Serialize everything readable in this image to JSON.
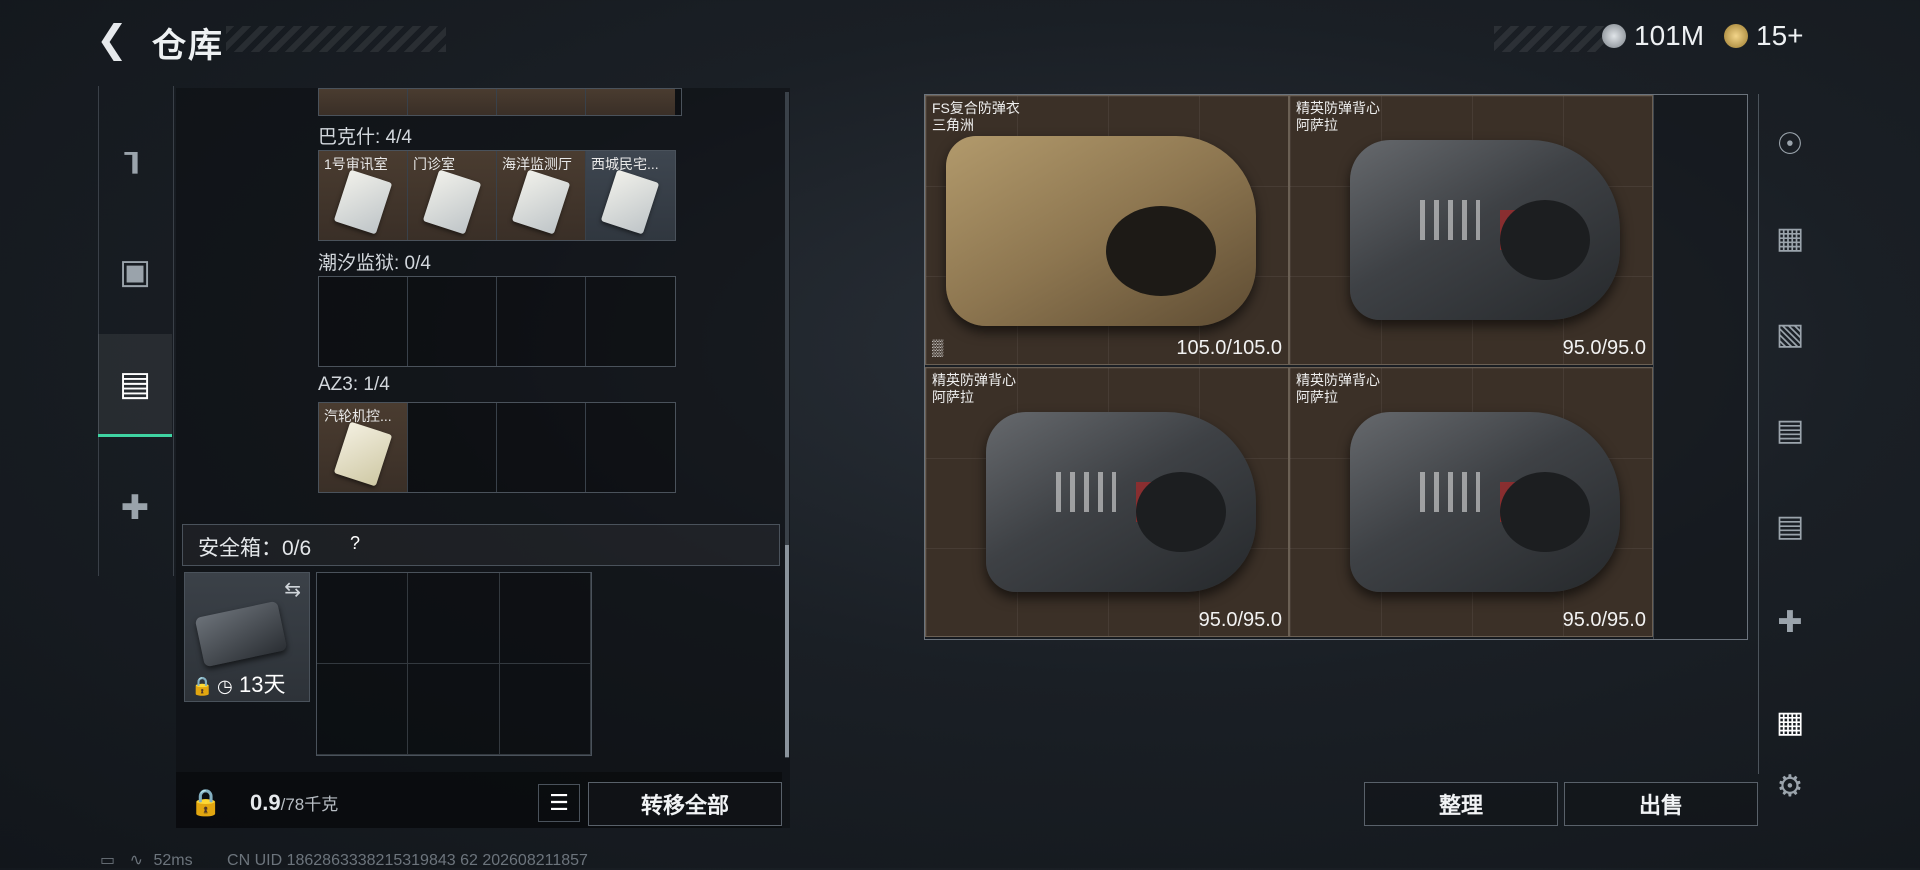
{
  "header": {
    "back_icon": "chevron-left-icon",
    "title": "仓库",
    "currencies": [
      {
        "icon": "coin-silver-icon",
        "value": "101M",
        "color": "#b8bfc6"
      },
      {
        "icon": "coin-gold-icon",
        "value": "15+",
        "color": "#d4b15e"
      }
    ]
  },
  "left_rail": {
    "items": [
      {
        "icon": "pistol-icon",
        "active": false
      },
      {
        "icon": "armor-icon",
        "active": false
      },
      {
        "icon": "backpack-icon",
        "active": true
      },
      {
        "icon": "medkit-icon",
        "active": false
      }
    ]
  },
  "keychains": [
    {
      "label": "巴克什: 4/4",
      "slots": [
        "1号审讯室",
        "门诊室",
        "海洋监测厅",
        "西城民宅..."
      ]
    },
    {
      "label": "潮汐监狱: 0/4",
      "slots": [
        "",
        "",
        "",
        ""
      ]
    },
    {
      "label": "AZ3: 1/4",
      "slots": [
        "汽轮机控...",
        "",
        "",
        ""
      ]
    }
  ],
  "safe_box": {
    "label": "安全箱：0/6",
    "help": "?",
    "duration": "13天",
    "swap_icon": "swap-arrows-icon"
  },
  "bottom": {
    "weight": "0.9",
    "weight_max": "/78千克",
    "transfer_all": "转移全部"
  },
  "items": [
    {
      "name": "FS复合防弹衣",
      "source": "三角洲",
      "durability": "105.0/105.0",
      "style": "tan",
      "no_container": true
    },
    {
      "name": "精英防弹背心",
      "source": "阿萨拉",
      "durability": "95.0/95.0",
      "style": "black"
    },
    {
      "name": "精英防弹背心",
      "source": "阿萨拉",
      "durability": "95.0/95.0",
      "style": "black"
    },
    {
      "name": "精英防弹背心",
      "source": "阿萨拉",
      "durability": "95.0/95.0",
      "style": "black"
    }
  ],
  "actions": {
    "organize": "整理",
    "sell": "出售"
  },
  "right_rail": [
    "helmet-icon",
    "armor-tier-icon",
    "backpack-tier-icon",
    "rig-tier-icon",
    "rig-tier-icon",
    "medkit-tier-icon",
    "armor-slot-icon",
    "gear-icon"
  ],
  "status_bar": {
    "ping": "52ms",
    "uid": "CN UID 1862863338215319843 62 202608211857"
  }
}
